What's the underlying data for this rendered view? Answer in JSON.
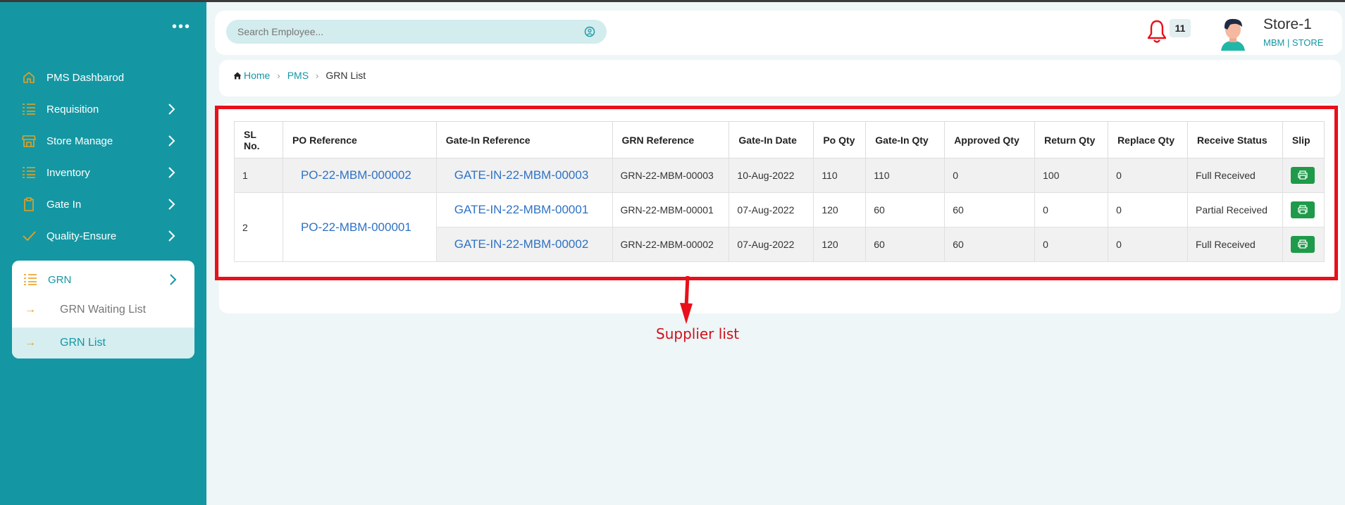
{
  "sidebar": {
    "menu_dots": "•••",
    "items": [
      {
        "label": "PMS Dashbarod",
        "icon": "home-icon",
        "has_chevron": false
      },
      {
        "label": "Requisition",
        "icon": "list-icon",
        "has_chevron": true
      },
      {
        "label": "Store Manage",
        "icon": "store-icon",
        "has_chevron": true
      },
      {
        "label": "Inventory",
        "icon": "list-icon",
        "has_chevron": true
      },
      {
        "label": "Gate In",
        "icon": "clipboard-icon",
        "has_chevron": true
      },
      {
        "label": "Quality-Ensure",
        "icon": "check-icon",
        "has_chevron": true
      }
    ],
    "grn": {
      "label": "GRN",
      "icon": "list-icon",
      "subitems": [
        {
          "label": "GRN Waiting List",
          "active": false
        },
        {
          "label": "GRN List",
          "active": true
        }
      ]
    },
    "accent_color": "#1497a3",
    "icon_color": "#e8a020"
  },
  "header": {
    "search_placeholder": "Search Employee...",
    "notification_count": "11",
    "user_name": "Store-1",
    "user_sub": "MBM  | STORE"
  },
  "breadcrumb": {
    "home": "Home",
    "pms": "PMS",
    "current": "GRN List"
  },
  "table": {
    "columns": [
      "SL No.",
      "PO Reference",
      "Gate-In Reference",
      "GRN Reference",
      "Gate-In Date",
      "Po Qty",
      "Gate-In Qty",
      "Approved Qty",
      "Return Qty",
      "Replace Qty",
      "Receive Status",
      "Slip"
    ],
    "groups": [
      {
        "sl": "1",
        "po_ref": "PO-22-MBM-000002",
        "rows": [
          {
            "gate_in_ref": "GATE-IN-22-MBM-00003",
            "grn_ref": "GRN-22-MBM-00003",
            "gate_in_date": "10-Aug-2022",
            "po_qty": "110",
            "gate_in_qty": "110",
            "approved_qty": "0",
            "return_qty": "100",
            "replace_qty": "0",
            "status": "Full Received"
          }
        ]
      },
      {
        "sl": "2",
        "po_ref": "PO-22-MBM-000001",
        "rows": [
          {
            "gate_in_ref": "GATE-IN-22-MBM-00001",
            "grn_ref": "GRN-22-MBM-00001",
            "gate_in_date": "07-Aug-2022",
            "po_qty": "120",
            "gate_in_qty": "60",
            "approved_qty": "60",
            "return_qty": "0",
            "replace_qty": "0",
            "status": "Partial Received"
          },
          {
            "gate_in_ref": "GATE-IN-22-MBM-00002",
            "grn_ref": "GRN-22-MBM-00002",
            "gate_in_date": "07-Aug-2022",
            "po_qty": "120",
            "gate_in_qty": "60",
            "approved_qty": "60",
            "return_qty": "0",
            "replace_qty": "0",
            "status": "Full Received"
          }
        ]
      }
    ],
    "slip_icon": "print-icon"
  },
  "annotation": {
    "label": "Supplier list",
    "color": "#e8101a"
  }
}
